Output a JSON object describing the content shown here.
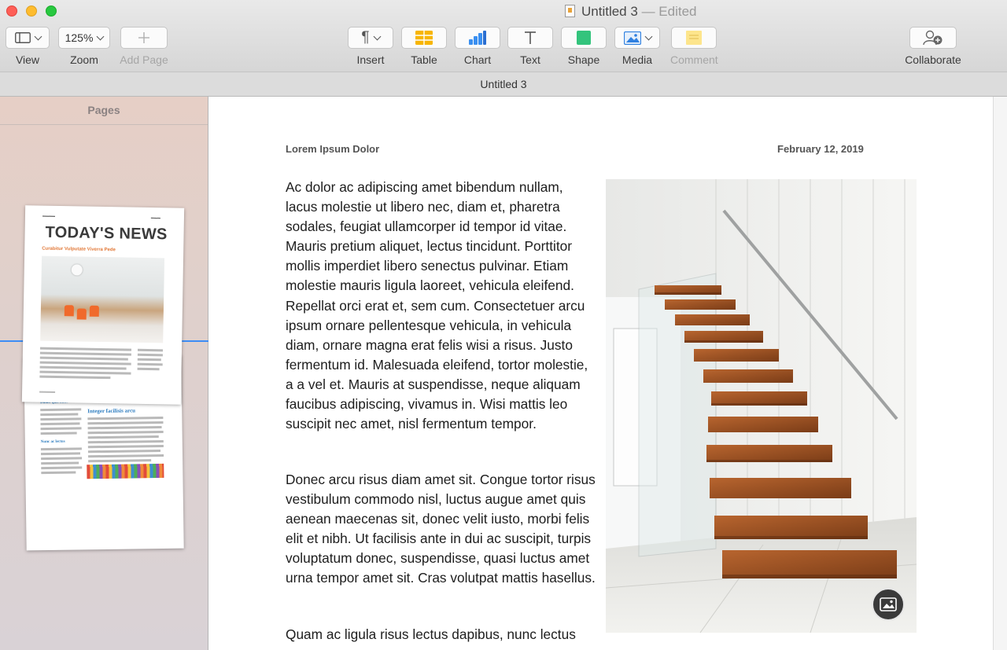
{
  "window": {
    "title": "Untitled 3",
    "status": "— Edited",
    "tab_title": "Untitled 3"
  },
  "toolbar": {
    "view_label": "View",
    "zoom_value": "125%",
    "zoom_label": "Zoom",
    "add_page_label": "Add Page",
    "insert_label": "Insert",
    "table_label": "Table",
    "chart_label": "Chart",
    "text_label": "Text",
    "shape_label": "Shape",
    "media_label": "Media",
    "comment_label": "Comment",
    "collaborate_label": "Collaborate"
  },
  "sidebar": {
    "title": "Pages",
    "thumbnails": [
      {
        "headline": "TODAY'S NEWS",
        "subhead": "Curabitur Vulputate Viverra Pede"
      },
      {
        "headings": [
          "Integer facilisis arcu",
          "Donec quis nunc",
          "Nunc ac lectus"
        ]
      }
    ]
  },
  "document": {
    "header_left": "Lorem Ipsum Dolor",
    "header_right": "February 12, 2019",
    "paragraphs": [
      "Ac dolor ac adipiscing amet bibendum nullam, lacus molestie ut libero nec, diam et, pharetra sodales, feugiat ullamcorper id tempor id vitae. Mauris pretium aliquet, lectus tincidunt. Porttitor mollis imperdiet libero senectus pulvinar. Etiam molestie mauris ligula laoreet, vehicula eleifend. Repellat orci erat et, sem cum. Consectetuer arcu ipsum ornare pellentesque vehicula, in vehicula diam, ornare magna erat felis wisi a risus. Justo fermentum id. Malesuada eleifend, tortor molestie, a a vel et. Mauris at suspendisse, neque aliquam faucibus adipiscing, vivamus in. Wisi mattis leo suscipit nec amet, nisl fermentum tempor.",
      "Donec arcu risus diam amet sit. Congue tortor risus vestibulum commodo nisl, luctus augue amet quis aenean maecenas sit, donec velit iusto, morbi felis elit et nibh. Ut facilisis ante in dui ac suscipit, turpis voluptatum donec, suspendisse, quasi luctus amet urna tempor amet sit. Cras volutpat mattis hasellus.",
      "Quam ac ligula risus lectus dapibus, nunc lectus"
    ]
  },
  "colors": {
    "accent": "#3d8df5",
    "orange": "#e27a3a",
    "blue_heading": "#2b7bbf"
  }
}
